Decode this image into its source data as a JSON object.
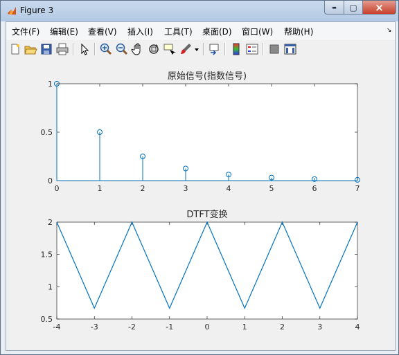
{
  "window": {
    "title": "Figure 3",
    "close_glyph": "×",
    "min_glyph": "▬",
    "max_glyph": "▢"
  },
  "menu": {
    "items": [
      "文件(F)",
      "编辑(E)",
      "查看(V)",
      "插入(I)",
      "工具(T)",
      "桌面(D)",
      "窗口(W)",
      "帮助(H)"
    ],
    "overflow": "↘"
  },
  "toolbar": {
    "icons": [
      "new-figure-icon",
      "open-file-icon",
      "save-icon",
      "print-icon",
      "select-arrow-icon",
      "zoom-in-icon",
      "zoom-out-icon",
      "pan-hand-icon",
      "rotate-3d-icon",
      "data-cursor-icon",
      "brush-icon",
      "brush-dropdown-icon",
      "link-plot-icon",
      "colorbar-icon",
      "legend-icon",
      "hide-plot-tools-icon",
      "show-plot-tools-icon"
    ]
  },
  "chart_data": [
    {
      "type": "stem",
      "title": "原始信号(指数信号)",
      "x": [
        0,
        1,
        2,
        3,
        4,
        5,
        6,
        7
      ],
      "values": [
        1,
        0.5,
        0.25,
        0.125,
        0.0625,
        0.03125,
        0.015625,
        0.0078125
      ],
      "xlim": [
        0,
        7
      ],
      "ylim": [
        0,
        1
      ],
      "xticks": [
        "0",
        "1",
        "2",
        "3",
        "4",
        "5",
        "6",
        "7"
      ],
      "yticks": [
        "0",
        "0.5",
        "1"
      ],
      "color": "#0072bd"
    },
    {
      "type": "line",
      "title": "DTFT变换",
      "x": [
        -4,
        -3,
        -2,
        -1,
        0,
        1,
        2,
        3,
        4
      ],
      "values": [
        2,
        0.667,
        2,
        0.667,
        2,
        0.667,
        2,
        0.667,
        2
      ],
      "xlim": [
        -4,
        4
      ],
      "ylim": [
        0.5,
        2
      ],
      "xticks": [
        "-4",
        "-3",
        "-2",
        "-1",
        "0",
        "1",
        "2",
        "3",
        "4"
      ],
      "yticks": [
        "0.5",
        "1",
        "1.5",
        "2"
      ],
      "color": "#0072bd"
    }
  ]
}
